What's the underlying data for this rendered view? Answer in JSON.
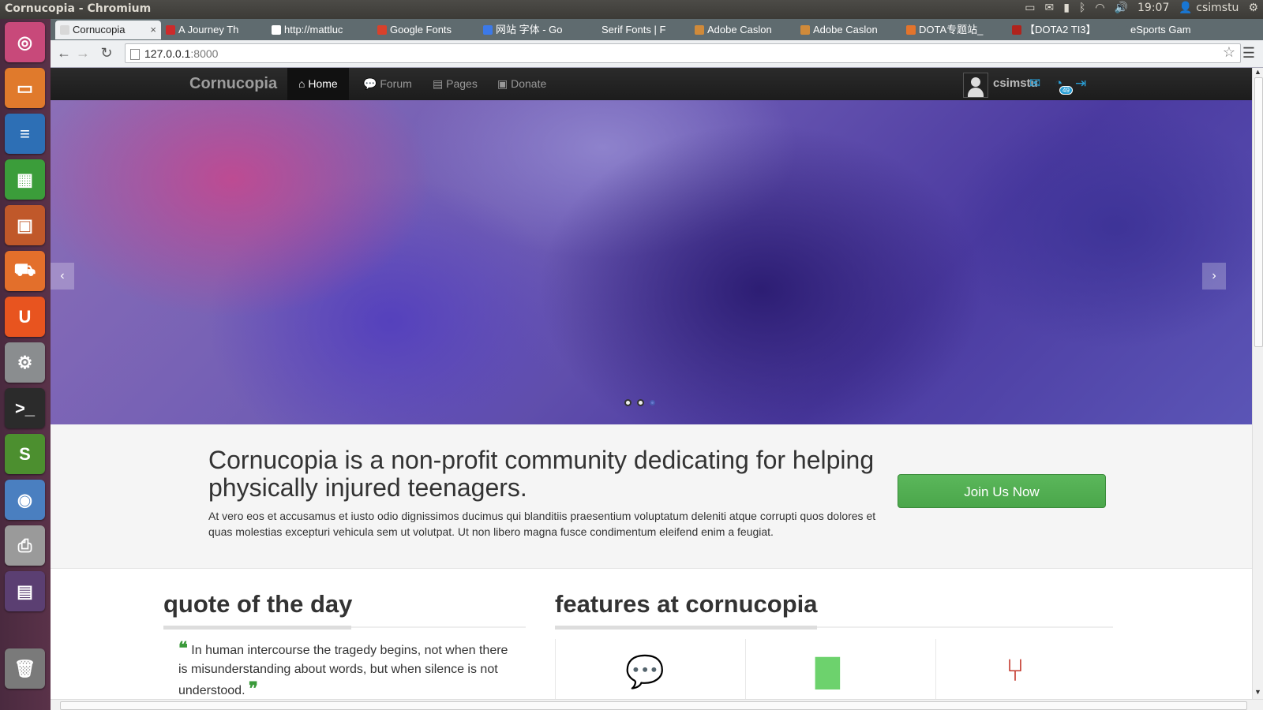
{
  "window": {
    "title": "Cornucopia - Chromium"
  },
  "tray": {
    "time": "19:07",
    "user": "csimstu"
  },
  "launcher": {
    "items": [
      {
        "name": "dash-home-icon",
        "glyph": "◎",
        "color": "#c8497a"
      },
      {
        "name": "files-icon",
        "glyph": "▭",
        "color": "#e07a2c"
      },
      {
        "name": "writer-icon",
        "glyph": "≡",
        "color": "#2d6fb5"
      },
      {
        "name": "calc-icon",
        "glyph": "▦",
        "color": "#3b9d3a"
      },
      {
        "name": "impress-icon",
        "glyph": "▣",
        "color": "#c0582a"
      },
      {
        "name": "software-center-icon",
        "glyph": "⛟",
        "color": "#e36f2b"
      },
      {
        "name": "ubuntu-one-icon",
        "glyph": "U",
        "color": "#e8541f"
      },
      {
        "name": "system-settings-icon",
        "glyph": "⚙",
        "color": "#8a8d8f"
      },
      {
        "name": "terminal-icon",
        "glyph": ">_",
        "color": "#2b2b2b"
      },
      {
        "name": "sublime-icon",
        "glyph": "S",
        "color": "#4c8f2f"
      },
      {
        "name": "chromium-icon",
        "glyph": "◉",
        "color": "#4a7fc0"
      },
      {
        "name": "scanner-icon",
        "glyph": "⎙",
        "color": "#9a9a9a"
      },
      {
        "name": "workspace-switcher-icon",
        "glyph": "▤",
        "color": "#5b3f72"
      },
      {
        "name": "trash-icon",
        "glyph": "🗑",
        "color": "#7a7a7a"
      }
    ]
  },
  "browser": {
    "tabs": [
      {
        "label": "Cornucopia",
        "active": true,
        "fav": "#d8d8d8"
      },
      {
        "label": "A Journey Th",
        "fav": "#cc2b2b"
      },
      {
        "label": "http://mattluc",
        "fav": "#ffffff"
      },
      {
        "label": "Google Fonts",
        "fav": "#d9412b"
      },
      {
        "label": "网站 字体 - Go",
        "fav": "#3c79e8"
      },
      {
        "label": "Serif Fonts | F",
        "fav": "#5f6b6f"
      },
      {
        "label": "Adobe Caslon",
        "fav": "#d08a3a"
      },
      {
        "label": "Adobe Caslon",
        "fav": "#d08a3a"
      },
      {
        "label": "DOTA专题站_",
        "fav": "#e3742c"
      },
      {
        "label": "【DOTA2 TI3】",
        "fav": "#b0231c"
      },
      {
        "label": "eSports Gam",
        "fav": "#5f6b6f"
      }
    ],
    "url_host": "127.0.0.1",
    "url_port": ":8000"
  },
  "site": {
    "brand": "Cornucopia",
    "nav": [
      {
        "label": "Home",
        "icon": "⌂",
        "active": true
      },
      {
        "label": "Forum",
        "icon": "💬"
      },
      {
        "label": "Pages",
        "icon": "▤"
      },
      {
        "label": "Donate",
        "icon": "▣"
      }
    ],
    "username": "csimstu",
    "message_count": "49",
    "carousel": {
      "slide_count": 3,
      "active_index": 2
    },
    "hero": {
      "heading": "Cornucopia is a non-profit community dedicating for helping physically injured teenagers.",
      "text": "At vero eos et accusamus et iusto odio dignissimos ducimus qui blanditiis praesentium voluptatum deleniti atque corrupti quos dolores et quas molestias excepturi vehicula sem ut volutpat. Ut non libero magna fusce condimentum eleifend enim a feugiat.",
      "cta": "Join Us Now"
    },
    "quote_section": {
      "title": "quote of the day",
      "quote": "In human intercourse the tragedy begins, not when there is misunderstanding about words, but when silence is not understood."
    },
    "features_section": {
      "title": "features at cornucopia",
      "items": [
        {
          "icon": "chat-bubbles-icon",
          "glyph": "💬",
          "color": "#1a9ee0"
        },
        {
          "icon": "document-icon",
          "glyph": "▇",
          "color": "#6dd26d"
        },
        {
          "icon": "fork-icon",
          "glyph": "⑂",
          "color": "#c43a2e"
        }
      ]
    }
  }
}
